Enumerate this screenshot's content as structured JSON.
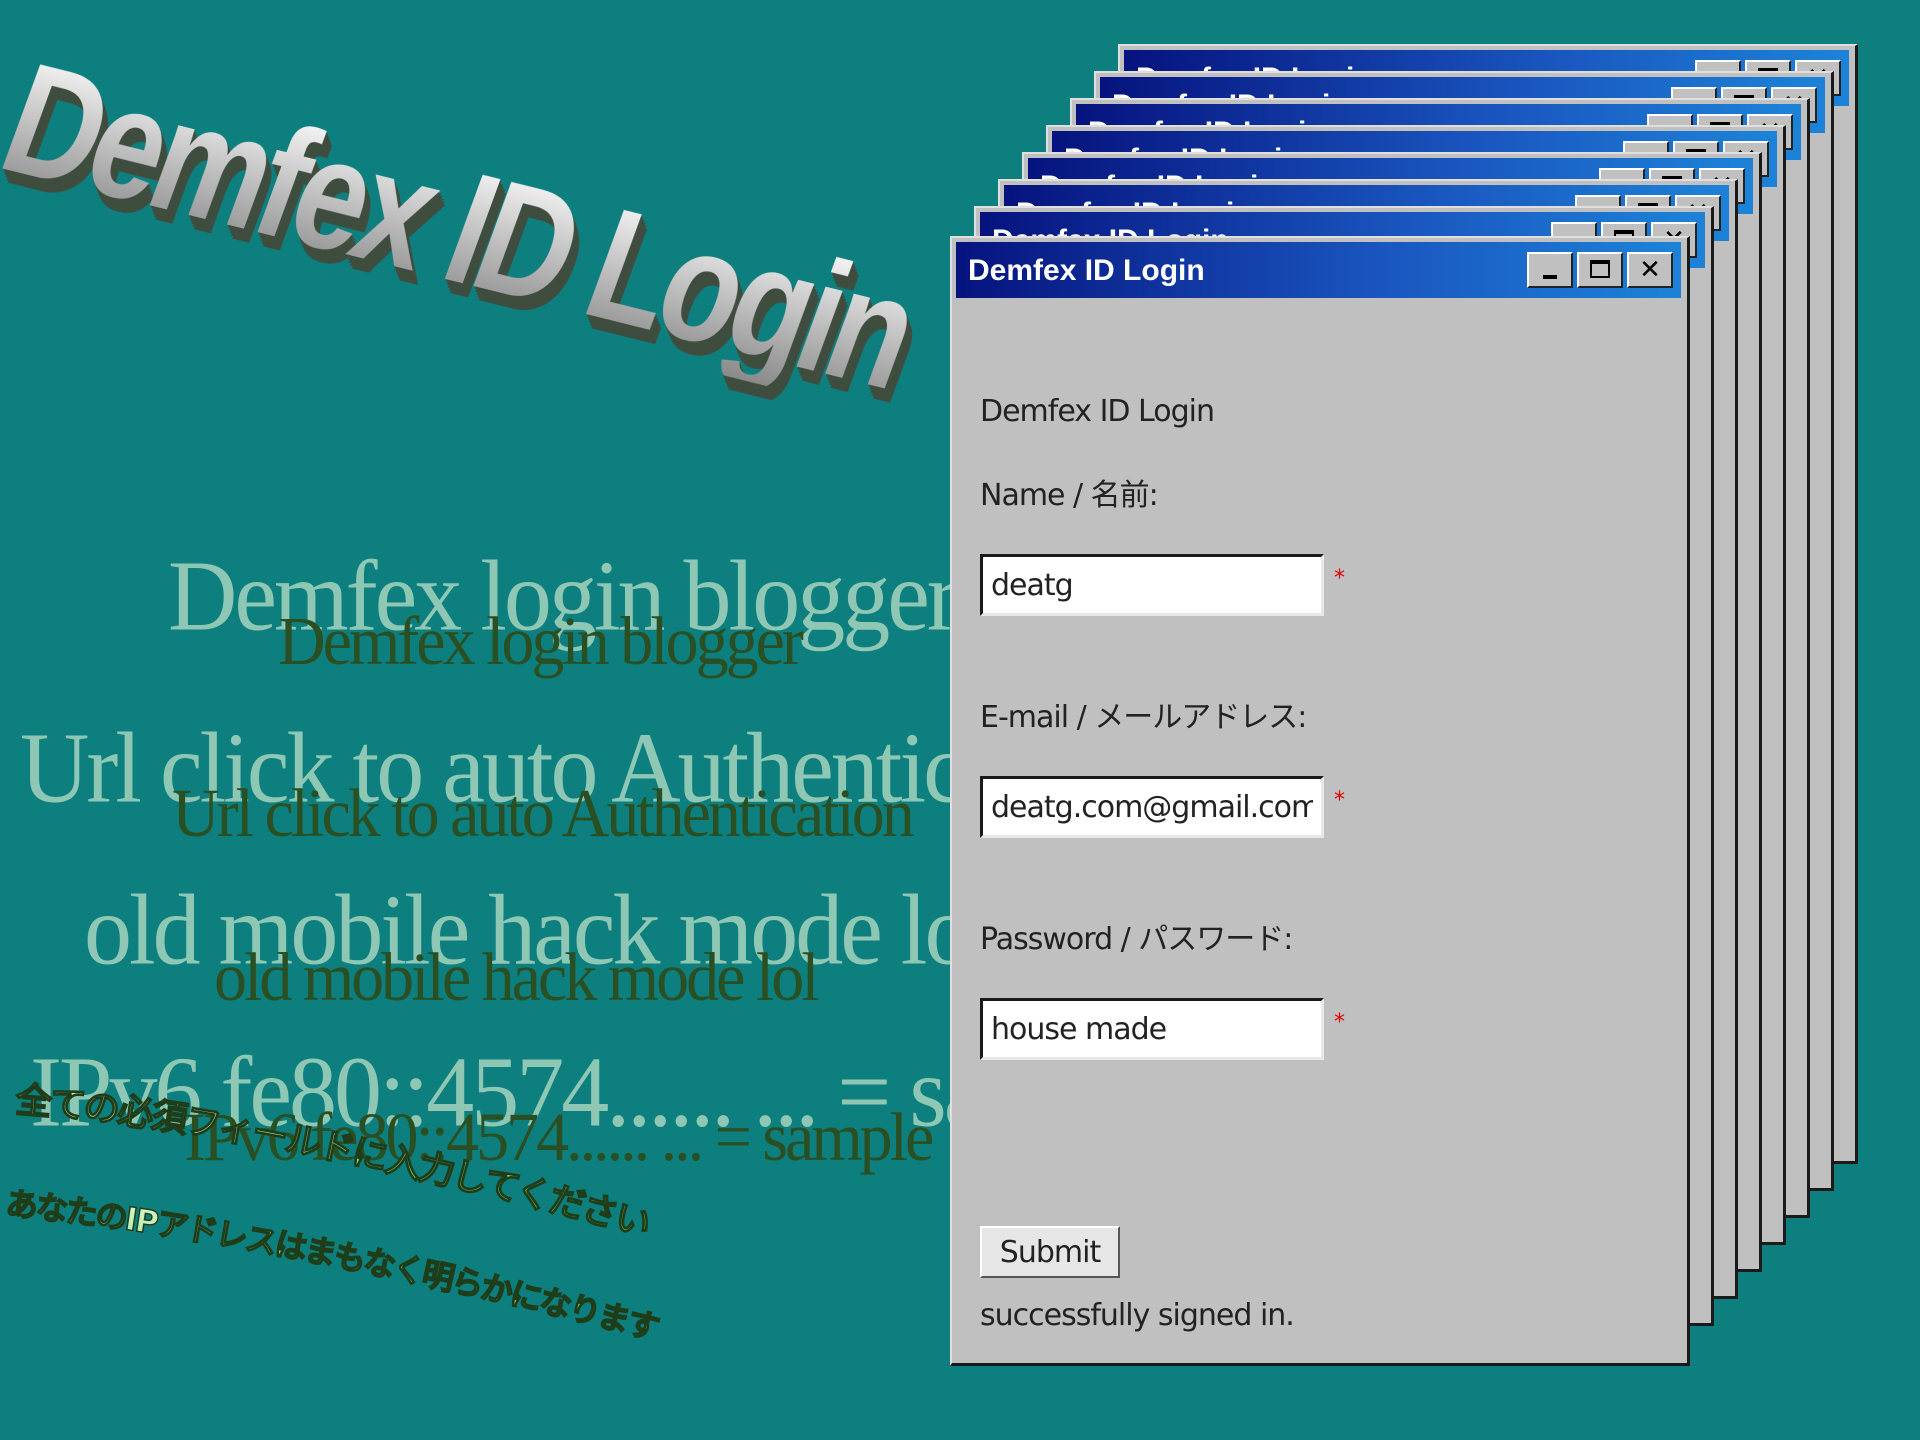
{
  "hero": {
    "title": "Demfex ID Login"
  },
  "blog": {
    "lines": [
      "Demfex login blogger",
      "Url click to auto Authentication",
      "old mobile hack mode lol",
      "IPv6 fe80::4574...... ... = sample"
    ]
  },
  "notices": {
    "line1": "全ての必須フィールドに入力してください",
    "line2": "あなたのIPアドレスはまもなく明らかになります"
  },
  "window": {
    "title": "Demfex ID Login",
    "heading": "Demfex ID Login",
    "close_glyph": "✕",
    "name_label": "Name / 名前:",
    "name_value": "deatg",
    "email_label": "E-mail / メールアドレス:",
    "email_value": "deatg.com@gmail.com",
    "password_label": "Password / パスワード:",
    "password_value": "house made",
    "required_mark": "*",
    "submit_label": "Submit",
    "status": "successfully signed in."
  },
  "colors": {
    "desktop": "#0d7f7f",
    "titlebar_start": "#06137e",
    "titlebar_end": "#1c83d8",
    "window_face": "#c0c0c0",
    "required": "#e00000"
  }
}
